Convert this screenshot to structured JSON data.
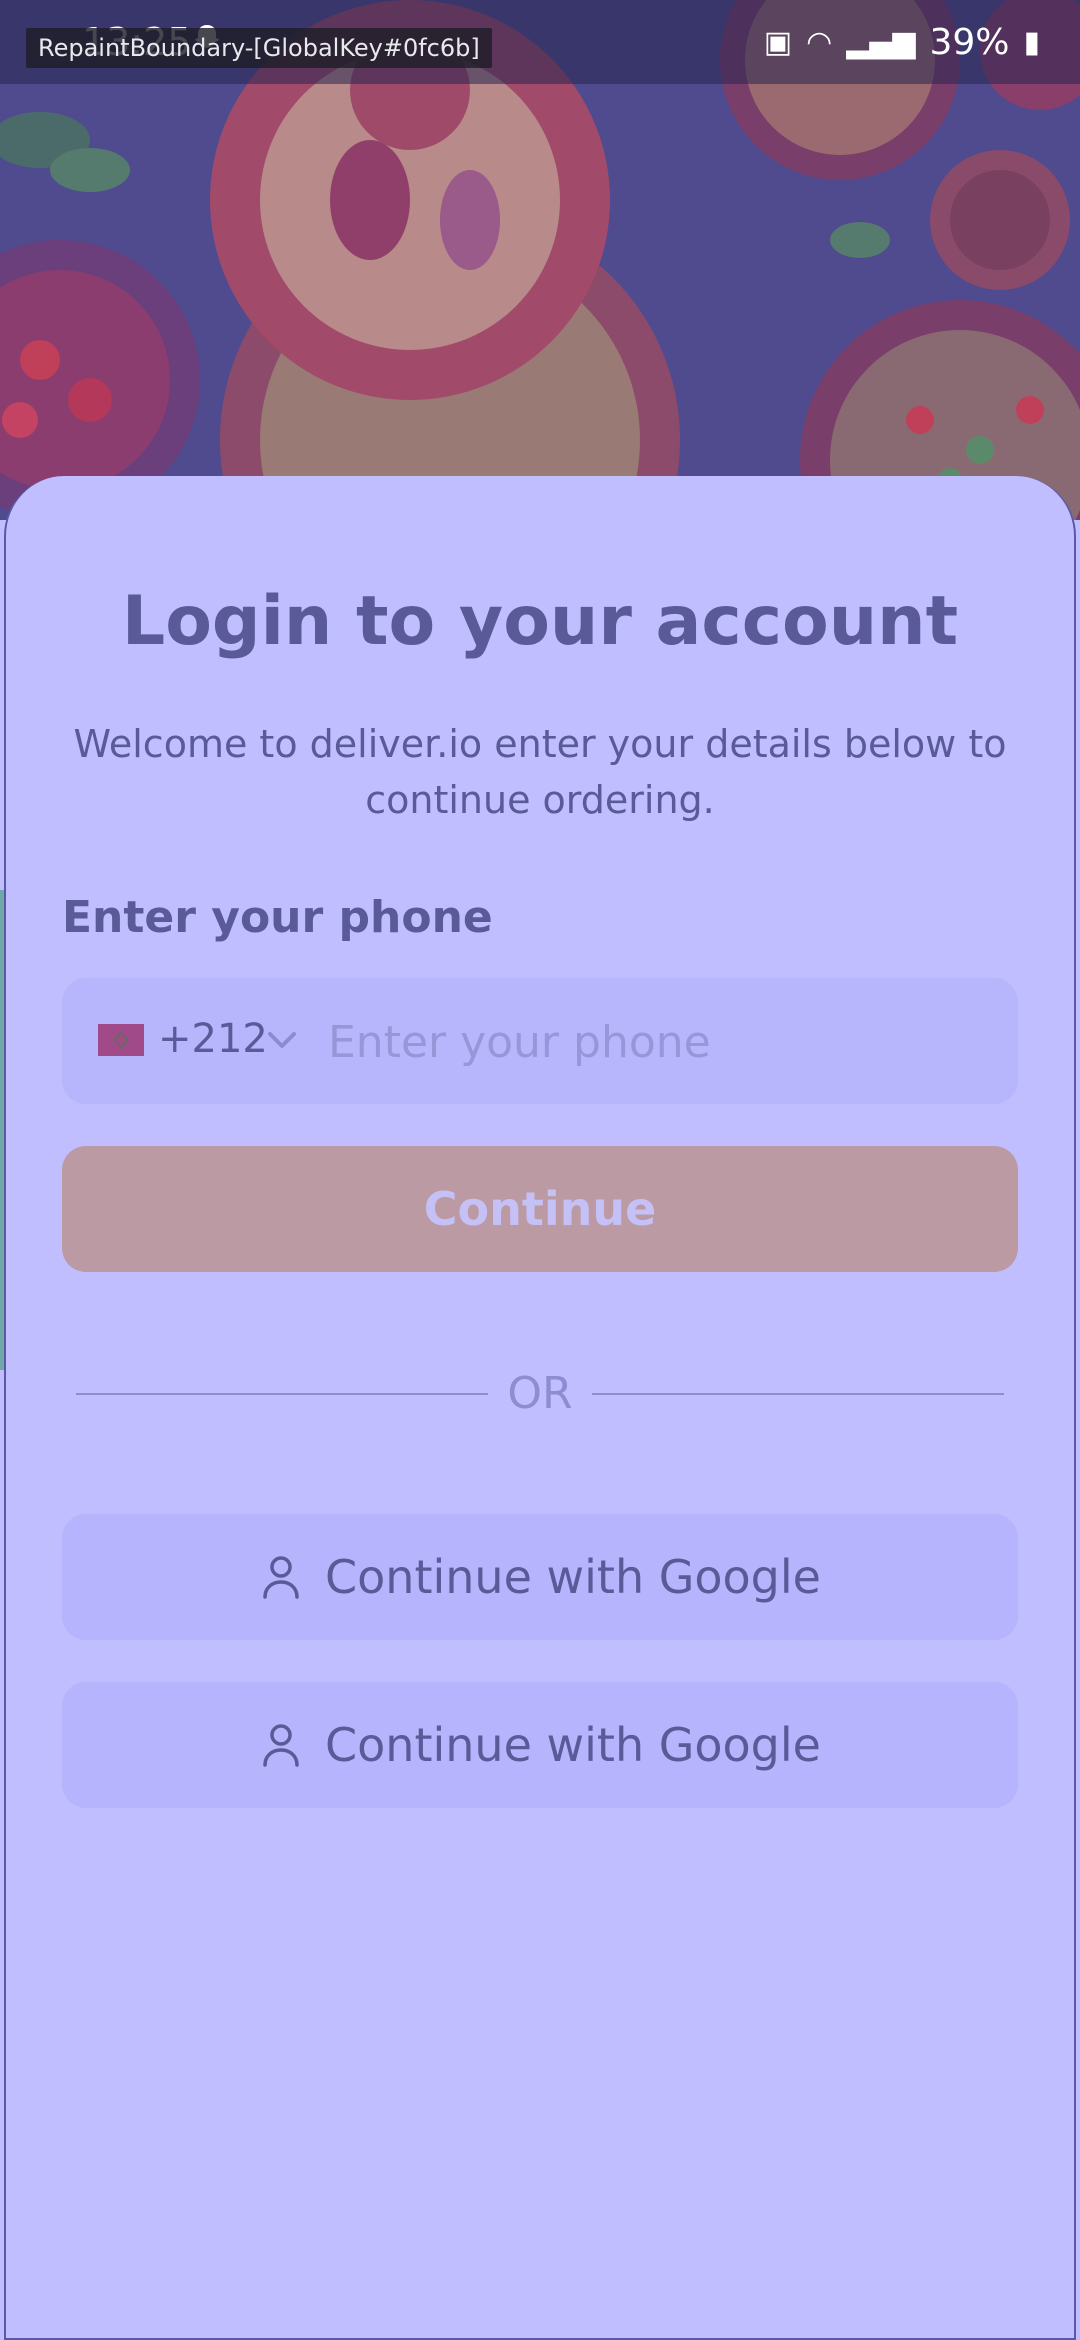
{
  "status_bar": {
    "time": "13:25",
    "battery": "39%",
    "debug_label": "RepaintBoundary-[GlobalKey#0fc6b]"
  },
  "login": {
    "title": "Login to your account",
    "subtitle": "Welcome to deliver.io enter your details below to continue ordering.",
    "phone_label": "Enter your phone",
    "dial_code": "+212",
    "phone_placeholder": "Enter your phone",
    "continue_label": "Continue",
    "or_label": "OR",
    "social_buttons": [
      {
        "label": "Continue with Google",
        "icon": "person-icon"
      },
      {
        "label": "Continue with Google",
        "icon": "person-icon"
      }
    ]
  },
  "colors": {
    "background": "#c0befe",
    "text": "#5a5a98",
    "continue_button": "#bb9aa4",
    "field": "#b7b5fc"
  }
}
